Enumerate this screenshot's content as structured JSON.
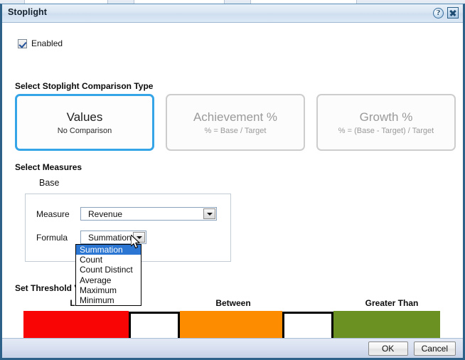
{
  "window": {
    "title": "Stoplight",
    "help_icon": "help-icon",
    "close_icon": "close-icon"
  },
  "enabled": {
    "label": "Enabled",
    "checked": true
  },
  "comparison": {
    "section_title": "Select Stoplight Comparison Type",
    "selected_index": 0,
    "options": [
      {
        "title": "Values",
        "subtitle": "No Comparison",
        "selected": true
      },
      {
        "title": "Achievement %",
        "subtitle": "% = Base / Target",
        "selected": false
      },
      {
        "title": "Growth %",
        "subtitle": "% = (Base - Target) / Target",
        "selected": false
      }
    ]
  },
  "measures": {
    "section_title": "Select Measures",
    "group_label": "Base",
    "measure": {
      "label": "Measure",
      "value": "Revenue"
    },
    "formula": {
      "label": "Formula",
      "value": "Summation",
      "open": true,
      "options": [
        {
          "label": "Summation",
          "highlighted": true
        },
        {
          "label": "Count",
          "highlighted": false
        },
        {
          "label": "Count Distinct",
          "highlighted": false
        },
        {
          "label": "Average",
          "highlighted": false
        },
        {
          "label": "Maximum",
          "highlighted": false
        },
        {
          "label": "Minimum",
          "highlighted": false
        }
      ]
    }
  },
  "thresholds": {
    "section_title": "Set Threshold Values",
    "headers": {
      "less_than": "Less Than",
      "between": "Between",
      "greater_than": "Greater Than"
    },
    "colors": {
      "low": "#fa0505",
      "mid": "#fd8c00",
      "high": "#6b9122"
    },
    "input_low": "",
    "input_high": ""
  },
  "footer": {
    "ok_label": "OK",
    "cancel_label": "Cancel"
  },
  "accent": {
    "selection_blue": "#36a5e8",
    "highlight_blue": "#2a76d2",
    "frame_blue": "#2e6189"
  }
}
